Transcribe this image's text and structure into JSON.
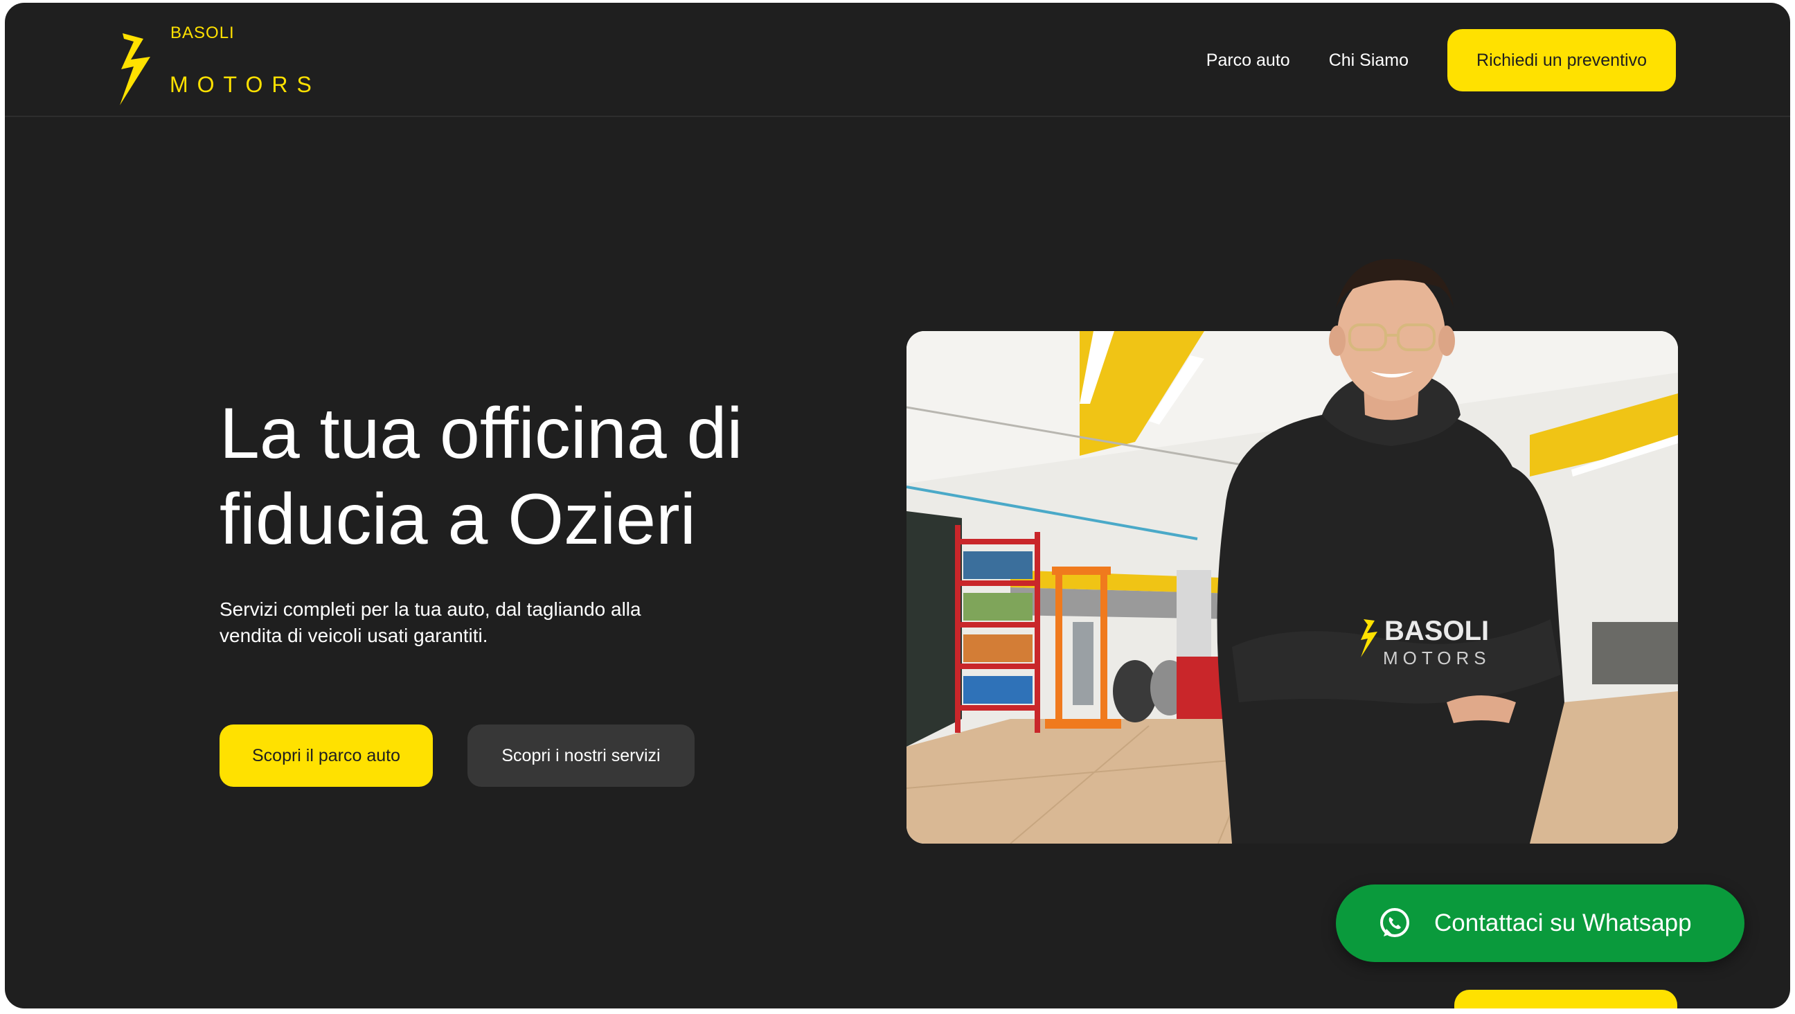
{
  "header": {
    "logo_top": "BASOLI",
    "logo_bottom": "MOTORS",
    "nav": [
      {
        "label": "Parco auto"
      },
      {
        "label": "Chi Siamo"
      }
    ],
    "cta_label": "Richiedi un preventivo"
  },
  "hero": {
    "title": "La tua officina di fiducia a Ozieri",
    "subtitle": "Servizi completi per la tua auto, dal tagliando alla vendita di veicoli usati garantiti.",
    "primary_button": "Scopri il parco auto",
    "secondary_button": "Scopri i nostri servizi",
    "hoodie_brand_top": "BASOLI",
    "hoodie_brand_bottom": "MOTORS"
  },
  "whatsapp": {
    "label": "Contattaci su Whatsapp",
    "icon": "whatsapp-icon"
  },
  "next_section": {
    "partial_heading": ""
  },
  "colors": {
    "background": "#1f1f1f",
    "accent": "#ffe100",
    "whatsapp": "#0a9a3c",
    "secondary_button": "#373737"
  }
}
